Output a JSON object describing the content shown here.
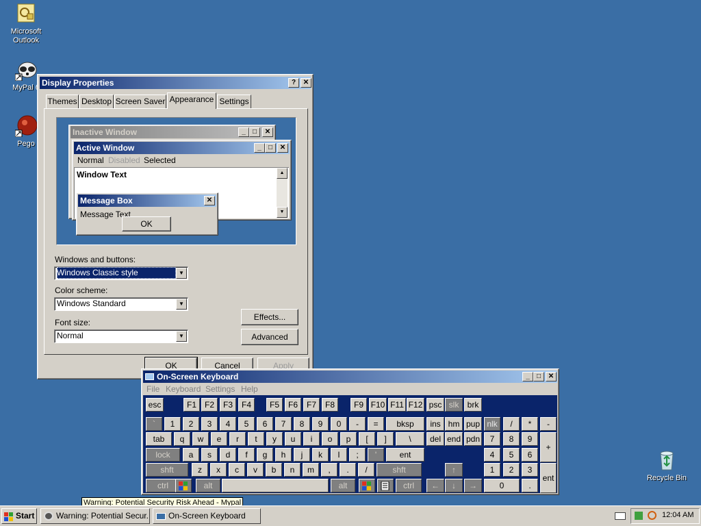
{
  "desktop": {
    "icons": [
      {
        "label_line1": "Microsoft",
        "label_line2": "Outlook",
        "icon": "outlook-icon"
      },
      {
        "label_line1": "MyPal 6",
        "label_line2": "",
        "icon": "mypal-icon"
      },
      {
        "label_line1": "Pego",
        "label_line2": "",
        "icon": "pego-icon"
      },
      {
        "label_line1": "Recycle Bin",
        "label_line2": "",
        "icon": "recycle-bin-icon"
      }
    ]
  },
  "display_properties": {
    "title": "Display Properties",
    "help_glyph": "?",
    "close_glyph": "✕",
    "tabs": [
      "Themes",
      "Desktop",
      "Screen Saver",
      "Appearance",
      "Settings"
    ],
    "preview": {
      "inactive_title": "Inactive Window",
      "active_title": "Active Window",
      "menu_normal": "Normal",
      "menu_disabled": "Disabled",
      "menu_selected": "Selected",
      "window_text": "Window Text",
      "msgbox_title": "Message Box",
      "msgbox_text": "Message Text",
      "msgbox_ok": "OK"
    },
    "windows_buttons_label": "Windows and buttons:",
    "windows_buttons_value": "Windows Classic style",
    "color_scheme_label": "Color scheme:",
    "color_scheme_value": "Windows Standard",
    "font_size_label": "Font size:",
    "font_size_value": "Normal",
    "effects_button": "Effects...",
    "advanced_button": "Advanced",
    "ok_button": "OK",
    "cancel_button": "Cancel",
    "apply_button": "Apply"
  },
  "osk": {
    "title": "On-Screen Keyboard",
    "menu": [
      "File",
      "Keyboard",
      "Settings",
      "Help"
    ],
    "row1": [
      "esc",
      "F1",
      "F2",
      "F3",
      "F4",
      "F5",
      "F6",
      "F7",
      "F8",
      "F9",
      "F10",
      "F11",
      "F12",
      "psc",
      "slk",
      "brk"
    ],
    "row2": [
      "`",
      "1",
      "2",
      "3",
      "4",
      "5",
      "6",
      "7",
      "8",
      "9",
      "0",
      "-",
      "=",
      "bksp",
      "ins",
      "hm",
      "pup",
      "nlk",
      "/",
      "*",
      "-"
    ],
    "row3": [
      "tab",
      "q",
      "w",
      "e",
      "r",
      "t",
      "y",
      "u",
      "i",
      "o",
      "p",
      "[",
      "]",
      "\\",
      "del",
      "end",
      "pdn",
      "7",
      "8",
      "9",
      "+"
    ],
    "row4": [
      "lock",
      "a",
      "s",
      "d",
      "f",
      "g",
      "h",
      "j",
      "k",
      "l",
      ";",
      "'",
      "ent",
      "4",
      "5",
      "6"
    ],
    "row5": [
      "shft",
      "z",
      "x",
      "c",
      "v",
      "b",
      "n",
      "m",
      ",",
      ".",
      "/",
      "shft",
      "↑",
      "1",
      "2",
      "3",
      "ent"
    ],
    "row6": [
      "ctrl",
      "alt",
      "alt",
      "ctrl",
      "←",
      "↓",
      "→",
      "0",
      "."
    ]
  },
  "tooltip": "Warning: Potential Security Risk Ahead - Mypal",
  "taskbar": {
    "start": "Start",
    "tasks": [
      "Warning: Potential Secur...",
      "On-Screen Keyboard"
    ],
    "clock": "12:04 AM"
  },
  "colors": {
    "desktop": "#3a6ea5",
    "active_title_start": "#0a246a",
    "active_title_end": "#a6caf0",
    "face": "#d4d0c8"
  }
}
